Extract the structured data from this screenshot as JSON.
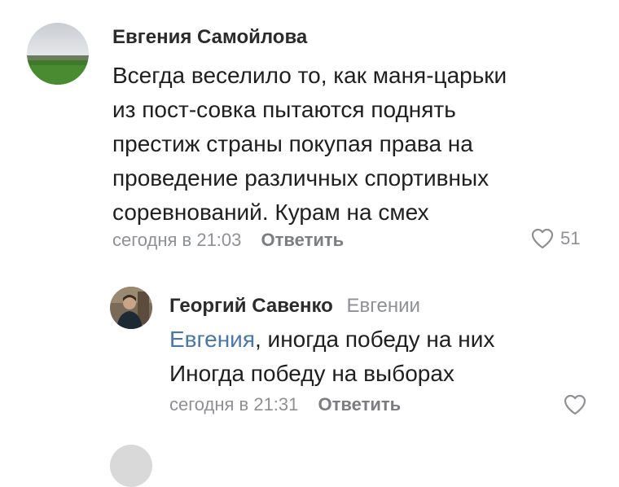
{
  "comment": {
    "author": "Евгения Самойлова",
    "text_lines": [
      "Всегда веселило то, как маня-царьки",
      "из пост-совка пытаются поднять",
      "престиж страны покупая права на",
      "проведение различных спортивных",
      "соревнований. Курам на смех"
    ],
    "time": "сегодня в 21:03",
    "reply_label": "Ответить",
    "likes": "51",
    "avatar_icon": "landscape-photo",
    "like_icon": "heart-outline-icon"
  },
  "reply": {
    "author": "Георгий Савенко",
    "reply_to": "Евгении",
    "mention": "Евгения",
    "text_line1_rest": ", иногда победу на них",
    "text_line2": "Иногда победу на выборах",
    "time": "сегодня в 21:31",
    "reply_label": "Ответить",
    "avatar_icon": "person-photo",
    "like_icon": "heart-outline-icon"
  },
  "colors": {
    "link": "#4a76a8",
    "meta": "#8e9094",
    "text": "#1f1f1f"
  }
}
